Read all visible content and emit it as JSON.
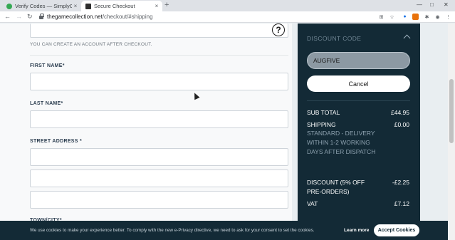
{
  "browser": {
    "tabs": [
      {
        "label": "Verify Codes — SimplyCod",
        "active": false
      },
      {
        "label": "Secure Checkout",
        "active": true
      }
    ],
    "new_tab": "+",
    "tab_close": "×",
    "url_host": "thegamecollection.net",
    "url_path": "/checkout/#shipping",
    "window_controls": {
      "minimize": "—",
      "maximize": "□",
      "close": "✕"
    }
  },
  "form": {
    "help_glyph": "?",
    "account_hint": "YOU CAN CREATE AN ACCOUNT AFTER CHECKOUT.",
    "first_name_label": "FIRST NAME",
    "last_name_label": "LAST NAME",
    "street_address_label": "STREET ADDRESS",
    "town_city_label": "TOWN/CITY",
    "required_marker": "*"
  },
  "summary": {
    "discount_title": "DISCOUNT CODE",
    "discount_code_value": "AUGFIVE",
    "cancel_label": "Cancel",
    "rows": {
      "subtotal_label": "SUB TOTAL",
      "subtotal_value": "£44.95",
      "shipping_label": "SHIPPING",
      "shipping_value": "£0.00",
      "shipping_desc": "STANDARD - DELIVERY WITHIN 1-2 WORKING DAYS AFTER DISPATCH",
      "discount_label": "DISCOUNT (5% OFF PRE-ORDERS)",
      "discount_value": "-£2.25",
      "vat_label": "VAT",
      "vat_value": "£7.12"
    }
  },
  "cookie_banner": {
    "text": "We use cookies to make your experience better. To comply with the new e-Privacy directive, we need to ask for your consent to set the cookies.",
    "learn_more": "Learn more",
    "accept": "Accept Cookies"
  },
  "colors": {
    "panel": "#132a36",
    "page_bg": "#e9eef1"
  }
}
